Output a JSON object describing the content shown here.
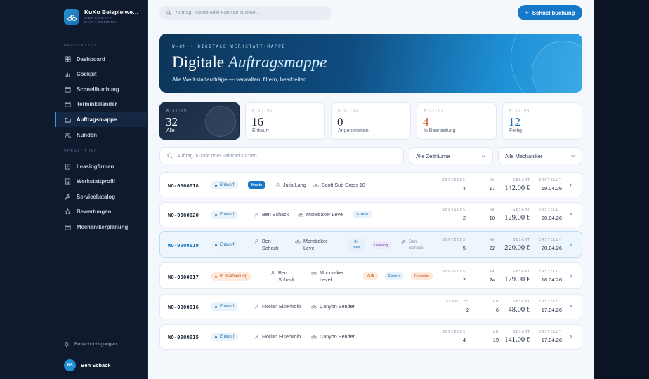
{
  "brand": {
    "title": "KuKo Beispielwer…",
    "subtitle": "WERKSTATT-MANAGEMENT"
  },
  "nav": {
    "section1": "NAVIGATION",
    "section2": "VERWALTUNG",
    "items": [
      {
        "label": "Dashboard"
      },
      {
        "label": "Cockpit"
      },
      {
        "label": "Schnellbuchung"
      },
      {
        "label": "Terminkalender"
      },
      {
        "label": "Auftragsmappe"
      },
      {
        "label": "Kunden"
      }
    ],
    "admin_items": [
      {
        "label": "Leasingfirmen"
      },
      {
        "label": "Werkstattprofil"
      },
      {
        "label": "Servicekatalog"
      },
      {
        "label": "Bewertungen"
      },
      {
        "label": "Mechanikerplanung"
      }
    ],
    "notifications": "Benachrichtigungen",
    "user_initials": "BS",
    "user_name": "Ben Schack"
  },
  "topbar": {
    "search_placeholder": "Auftrag, Kunde oder Fahrrad suchen…",
    "quick_label": "Schnellbuchung"
  },
  "hero": {
    "kicker": "W-OM · DIGITALE WERKSTATT-MAPPE",
    "title_plain": "Digitale",
    "title_italic": "Auftragsmappe",
    "subtitle": "Alle Werkstattaufträge — verwalten, filtern, bearbeiten."
  },
  "stats": [
    {
      "code": "W-ST-00",
      "value": "32",
      "label": "Alle",
      "color": "#ffffff"
    },
    {
      "code": "W-ST-01",
      "value": "16",
      "label": "Entwurf",
      "color": "#1d2a3c"
    },
    {
      "code": "W-ST-02",
      "value": "0",
      "label": "Angenommen",
      "color": "#1d2a3c"
    },
    {
      "code": "W-ST-03",
      "value": "4",
      "label": "In Bearbeitung",
      "color": "#c2551b"
    },
    {
      "code": "W-ST-04",
      "value": "12",
      "label": "Fertig",
      "color": "#1a70b8"
    }
  ],
  "filters": {
    "search_placeholder": "Auftrag, Kunde oder Fahrrad suchen…",
    "period": "Alle Zeiträume",
    "mechanic": "Alle Mechaniker"
  },
  "labels": {
    "services": "SERVICES",
    "aw": "AW",
    "total": "GESAMT",
    "created": "ERSTELLT"
  },
  "orders": [
    {
      "id": "WO-0000018",
      "status": "Entwurf",
      "tag": "Heute",
      "customer": "Julia Lang",
      "bike": "Scott Sub Cross 10",
      "services": "4",
      "aw": "17",
      "total": "142.00 €",
      "created": "19.04.26"
    },
    {
      "id": "WO-0000020",
      "status": "Entwurf",
      "customer": "Ben Schack",
      "bike": "Mondraker Level",
      "chip1": "E-Bike",
      "services": "2",
      "aw": "10",
      "total": "129.00 €",
      "created": "20.04.26"
    },
    {
      "id": "WO-0000019",
      "status": "Entwurf",
      "customer": "Ben Schack",
      "bike": "Mondraker Level",
      "chip1": "E-Bike",
      "chip2": "Leasing",
      "mechanic": "Ben Schack",
      "services": "5",
      "aw": "22",
      "total": "220.00 €",
      "created": "20.04.26"
    },
    {
      "id": "WO-0000017",
      "status": "In Bearbeitung",
      "customer": "Ben Schack",
      "bike": "Mondraker Level",
      "chip1": "KVA",
      "chip2": "Extern",
      "chip3": "Garantie",
      "services": "2",
      "aw": "24",
      "total": "179.00 €",
      "created": "18.04.26"
    },
    {
      "id": "WO-0000016",
      "status": "Entwurf",
      "customer": "Florian Eisenkolb",
      "bike": "Canyon Sender",
      "services": "2",
      "aw": "6",
      "total": "48.00 €",
      "created": "17.04.26"
    },
    {
      "id": "WO-0000015",
      "status": "Entwurf",
      "customer": "Florian Eisenkolb",
      "bike": "Canyon Sender",
      "services": "4",
      "aw": "19",
      "total": "141.00 €",
      "created": "17.04.26"
    }
  ]
}
